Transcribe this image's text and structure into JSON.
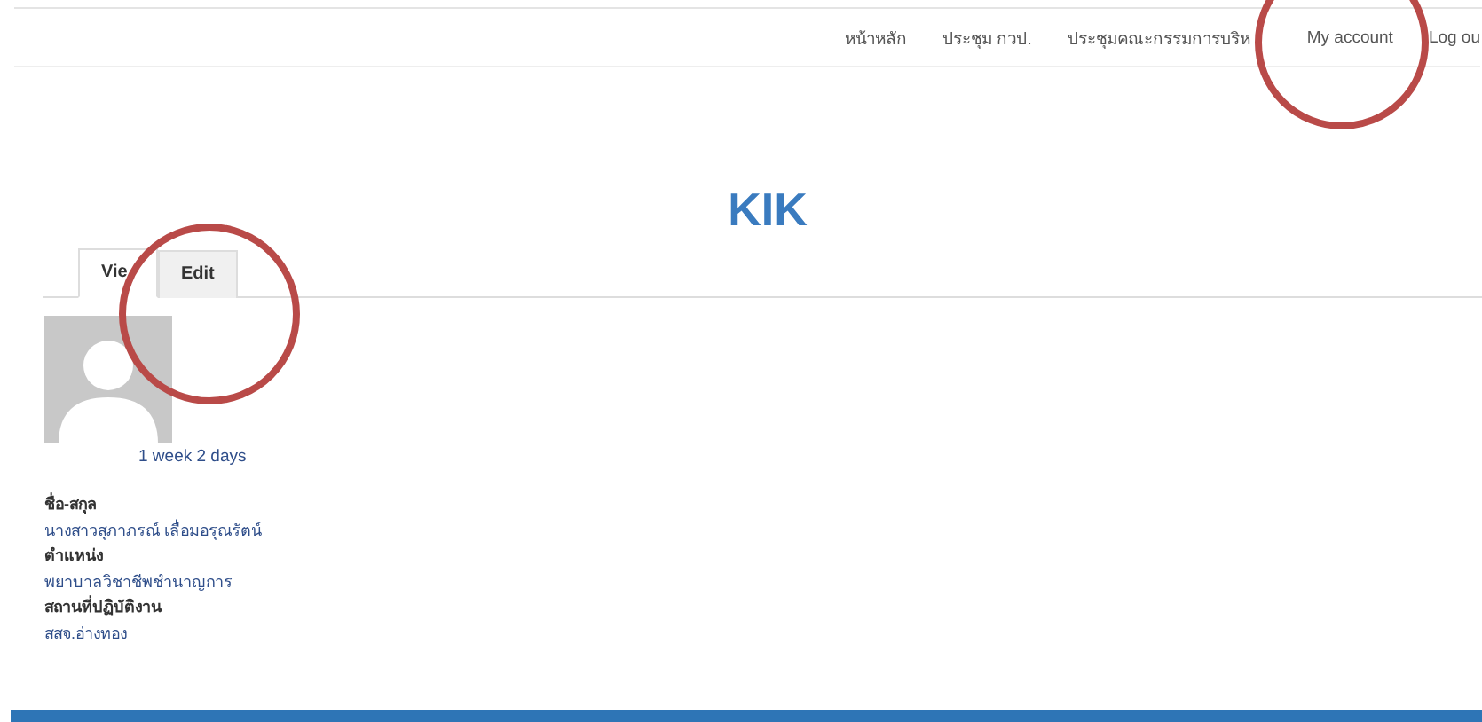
{
  "nav": [
    {
      "label": "หน้าหลัก"
    },
    {
      "label": "ประชุม กวป."
    },
    {
      "label": "ประชุมคณะกรรมการบริห"
    },
    {
      "label": "My account"
    },
    {
      "label": "Log ou"
    }
  ],
  "title": "KIK",
  "tabs": [
    {
      "label": "Vie",
      "selected": true
    },
    {
      "label": "Edit",
      "selected": false
    }
  ],
  "profile": {
    "member_for": "1 week 2 days",
    "fields": [
      {
        "label": "ชื่อ-สกุล",
        "value": "นางสาวสุภาภรณ์ เลื่อมอรุณรัตน์"
      },
      {
        "label": "ตำแหน่ง",
        "value": "พยาบาลวิชาชีพชำนาญการ"
      },
      {
        "label": "สถานที่ปฏิบัติงาน",
        "value": "สสจ.อ่างทอง"
      }
    ]
  }
}
